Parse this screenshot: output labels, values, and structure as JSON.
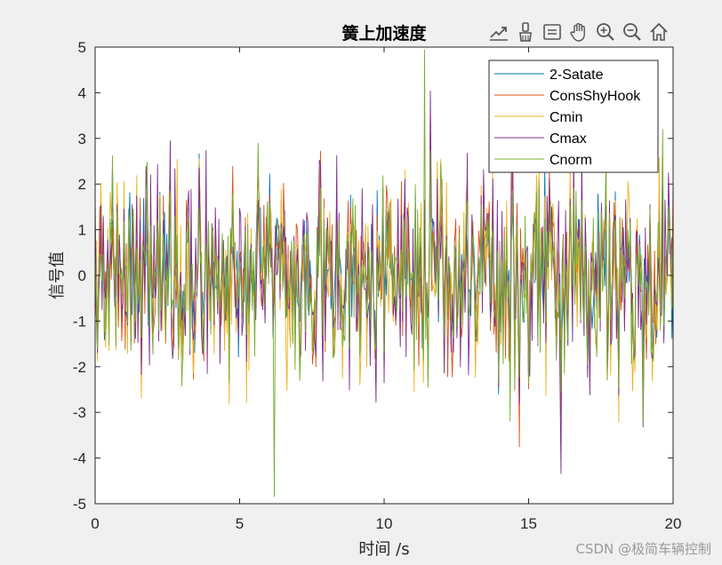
{
  "toolbar": {
    "icons": [
      "export-icon",
      "brush-icon",
      "datatip-icon",
      "pan-hand-icon",
      "zoom-in-icon",
      "zoom-out-icon",
      "home-icon"
    ]
  },
  "watermark": "CSDN @极简车辆控制",
  "colors": {
    "background": "#f0f0f0",
    "axes_bg": "#ffffff",
    "series": [
      "#0072BD",
      "#D95319",
      "#EDB120",
      "#7E2F8E",
      "#77AC30"
    ]
  },
  "chart_data": {
    "type": "line",
    "title": "簧上加速度",
    "xlabel": "时间 /s",
    "ylabel": "信号值",
    "xlim": [
      0,
      20
    ],
    "ylim": [
      -5,
      5
    ],
    "xticks": [
      0,
      5,
      10,
      15,
      20
    ],
    "yticks": [
      -5,
      -4,
      -3,
      -2,
      -1,
      0,
      1,
      2,
      3,
      4,
      5
    ],
    "grid": false,
    "legend_position": "top-right",
    "x_step": 0.04,
    "series": [
      {
        "name": "2-Satate",
        "amplitude": 1.15,
        "seed": 11
      },
      {
        "name": "ConsShyHook",
        "amplitude": 1.2,
        "seed": 23
      },
      {
        "name": "Cmin",
        "amplitude": 1.3,
        "seed": 37
      },
      {
        "name": "Cmax",
        "amplitude": 1.45,
        "seed": 51
      },
      {
        "name": "Cnorm",
        "amplitude": 1.25,
        "seed": 71
      }
    ],
    "annotations": {
      "max_peak": {
        "x": 11.4,
        "y": 4.95
      },
      "min_peak": {
        "x": 6.2,
        "y": -4.85
      }
    }
  }
}
